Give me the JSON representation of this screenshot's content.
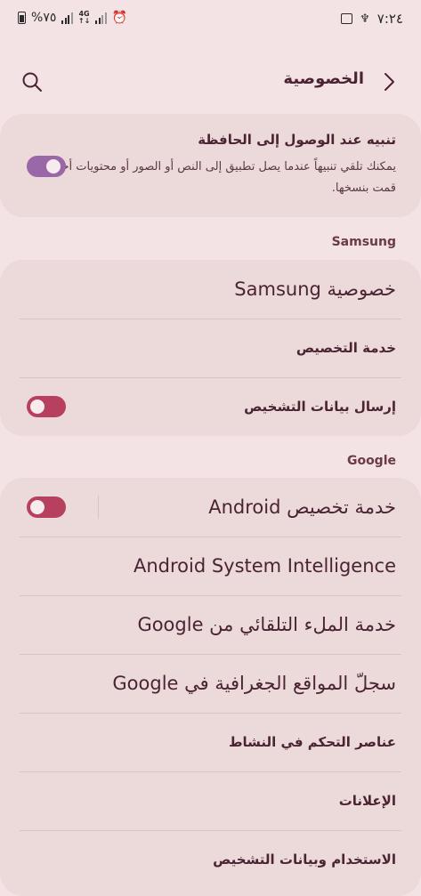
{
  "status_bar": {
    "battery": "%٧٥",
    "network": "4G",
    "time": "٧:٢٤"
  },
  "header": {
    "title": "الخصوصية"
  },
  "clipboard": {
    "title": "تنبيه عند الوصول إلى الحافظة",
    "description": "يمكنك تلقي تنبيهاً عندما يصل تطبيق إلى النص أو الصور أو محتويات أخرى قمت بنسخها.",
    "toggle_on": true
  },
  "samsung": {
    "section_title": "Samsung",
    "items": [
      {
        "label": "خصوصية Samsung"
      },
      {
        "label": "خدمة التخصيص"
      },
      {
        "label": "إرسال بيانات التشخيص",
        "toggle_on": false
      }
    ]
  },
  "google": {
    "section_title": "Google",
    "items": [
      {
        "label": "خدمة تخصيص Android",
        "toggle_on": false
      },
      {
        "label": "Android System Intelligence"
      },
      {
        "label": "خدمة الملء التلقائي من Google"
      },
      {
        "label": "سجلّ المواقع الجغرافية في Google"
      },
      {
        "label": "عناصر التحكم في النشاط"
      },
      {
        "label": "الإعلانات"
      },
      {
        "label": "الاستخدام وبيانات التشخيص"
      }
    ]
  },
  "colors": {
    "background": "#f4e3e4",
    "card": "#ecd9da",
    "toggle_on": "#9a67a8",
    "toggle_off": "#b8405f"
  }
}
